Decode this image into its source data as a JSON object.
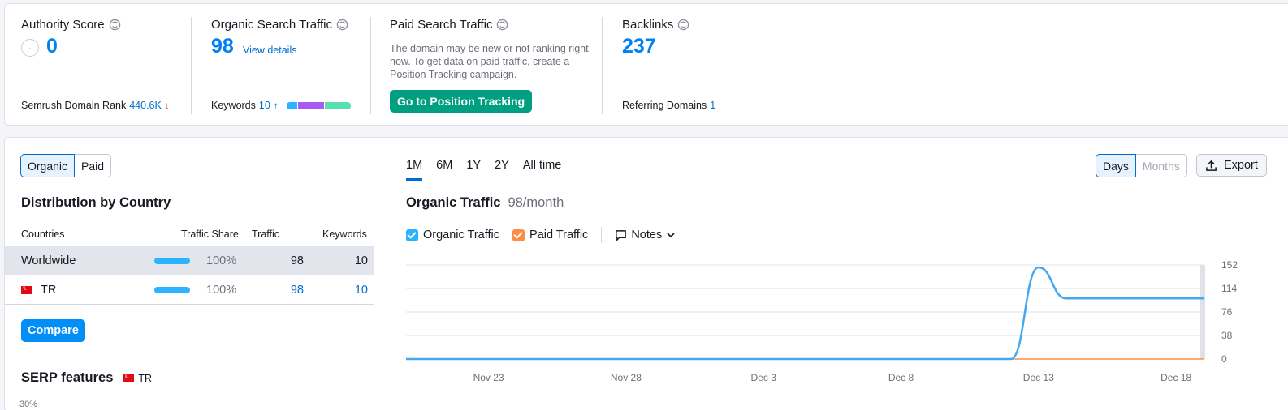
{
  "summary": {
    "authority": {
      "title": "Authority Score",
      "value": "0",
      "footer_label": "Semrush Domain Rank",
      "footer_value": "440.6K"
    },
    "organic": {
      "title": "Organic Search Traffic",
      "value": "98",
      "link": "View details",
      "footer_label": "Keywords",
      "footer_value": "10"
    },
    "paid": {
      "title": "Paid Search Traffic",
      "description": "The domain may be new or not ranking right now. To get data on paid traffic, create a Position Tracking campaign.",
      "button": "Go to Position Tracking"
    },
    "backlinks": {
      "title": "Backlinks",
      "value": "237",
      "footer_label": "Referring Domains",
      "footer_value": "1"
    }
  },
  "left": {
    "toggle": [
      "Organic",
      "Paid"
    ],
    "distribution_title": "Distribution by Country",
    "columns": [
      "Countries",
      "Traffic Share",
      "Traffic",
      "Keywords"
    ],
    "rows": [
      {
        "country": "Worldwide",
        "share": "100%",
        "share_value": 100,
        "traffic": "98",
        "keywords": "10"
      },
      {
        "country": "TR",
        "share": "100%",
        "share_value": 100,
        "traffic": "98",
        "keywords": "10"
      }
    ],
    "compare_button": "Compare",
    "serp_title": "SERP features",
    "serp_country": "TR",
    "serp_axis_peek": "30%"
  },
  "chart_header": {
    "ranges": [
      "1M",
      "6M",
      "1Y",
      "2Y",
      "All time"
    ],
    "active_range": "1M",
    "title": "Organic Traffic",
    "subtitle": "98/month",
    "legend": [
      {
        "label": "Organic Traffic",
        "color": "#2bb3ff"
      },
      {
        "label": "Paid Traffic",
        "color": "#ff8c43"
      }
    ],
    "notes": "Notes",
    "granularity": [
      "Days",
      "Months"
    ],
    "export": "Export"
  },
  "chart_data": {
    "type": "line",
    "x": [
      "Nov 20",
      "Nov 21",
      "Nov 22",
      "Nov 23",
      "Nov 24",
      "Nov 25",
      "Nov 26",
      "Nov 27",
      "Nov 28",
      "Nov 29",
      "Nov 30",
      "Dec 1",
      "Dec 2",
      "Dec 3",
      "Dec 4",
      "Dec 5",
      "Dec 6",
      "Dec 7",
      "Dec 8",
      "Dec 9",
      "Dec 10",
      "Dec 11",
      "Dec 12",
      "Dec 13",
      "Dec 14",
      "Dec 15",
      "Dec 16",
      "Dec 17",
      "Dec 18",
      "Dec 19"
    ],
    "x_ticks": [
      "Nov 23",
      "Nov 28",
      "Dec 3",
      "Dec 8",
      "Dec 13",
      "Dec 18"
    ],
    "series": [
      {
        "name": "Organic Traffic",
        "color": "#44a8f0",
        "values": [
          0,
          0,
          0,
          0,
          0,
          0,
          0,
          0,
          0,
          0,
          0,
          0,
          0,
          0,
          0,
          0,
          0,
          0,
          0,
          0,
          0,
          0,
          0,
          148,
          98,
          98,
          98,
          98,
          98,
          98
        ]
      },
      {
        "name": "Paid Traffic",
        "color": "#ff8c43",
        "values": [
          0,
          0,
          0,
          0,
          0,
          0,
          0,
          0,
          0,
          0,
          0,
          0,
          0,
          0,
          0,
          0,
          0,
          0,
          0,
          0,
          0,
          0,
          0,
          0,
          0,
          0,
          0,
          0,
          0,
          0
        ]
      }
    ],
    "y_ticks": [
      0,
      38,
      76,
      114,
      152
    ],
    "ylim": [
      0,
      152
    ],
    "grid": true
  }
}
